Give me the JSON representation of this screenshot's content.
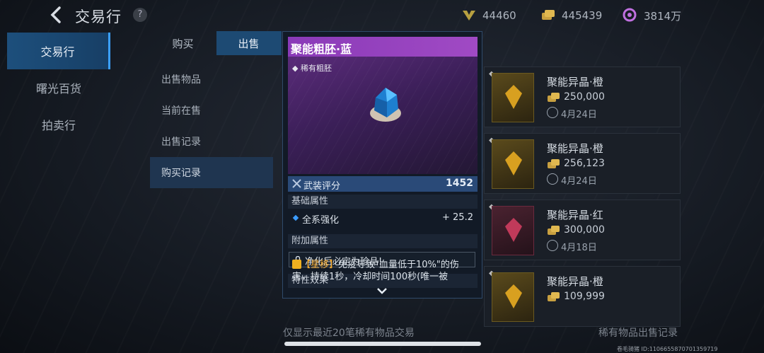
{
  "header": {
    "title": "交易行",
    "help": "?",
    "currencies": [
      {
        "icon": "rank-badge-icon",
        "value": "44460"
      },
      {
        "icon": "gold-coin-icon",
        "value": "445439"
      },
      {
        "icon": "credit-icon",
        "value": "3814万"
      }
    ]
  },
  "sidebar": {
    "items": [
      {
        "label": "交易行",
        "active": true
      },
      {
        "label": "曙光百货",
        "active": false
      },
      {
        "label": "拍卖行",
        "active": false
      }
    ]
  },
  "tabs": {
    "buy": "购买",
    "sell": "出售"
  },
  "submenu": {
    "items": [
      {
        "label": "出售物品"
      },
      {
        "label": "当前在售"
      },
      {
        "label": "出售记录"
      },
      {
        "label": "购买记录",
        "active": true
      }
    ]
  },
  "records": [
    {
      "name": "聚能异晶·橙",
      "price": "250,000",
      "date": "4月24日",
      "color": "#d8a020"
    },
    {
      "name": "聚能异晶·橙",
      "price": "256,123",
      "date": "4月24日",
      "color": "#d8a020"
    },
    {
      "name": "聚能异晶·红",
      "price": "300,000",
      "date": "4月18日",
      "color": "#c03a5a"
    },
    {
      "name": "聚能异晶·橙",
      "price": "109,999",
      "date": "",
      "color": "#d8a020"
    }
  ],
  "footer": {
    "left": "仅显示最近20笔稀有物品交易",
    "right": "稀有物品出售记录",
    "player_id": "卷毛骑猪 ID:1106655870701359719"
  },
  "item_panel": {
    "name": "聚能粗胚·蓝",
    "rarity": "稀有粗胚",
    "score_label": "武装评分",
    "score_value": "1452",
    "base_section": "基础属性",
    "base_attr_label": "全系强化",
    "base_attr_value": "+ 25.2",
    "extra_section": "附加属性",
    "lock_text": "净化后必定为珍品!",
    "trait_section": "特性效果",
    "trait_tag": "【星移】",
    "trait_text": "免疫导致\"血量低于10%\"的伤害，持续1秒，冷却时间100秒(唯一被",
    "header_color": "#9a44c0"
  }
}
